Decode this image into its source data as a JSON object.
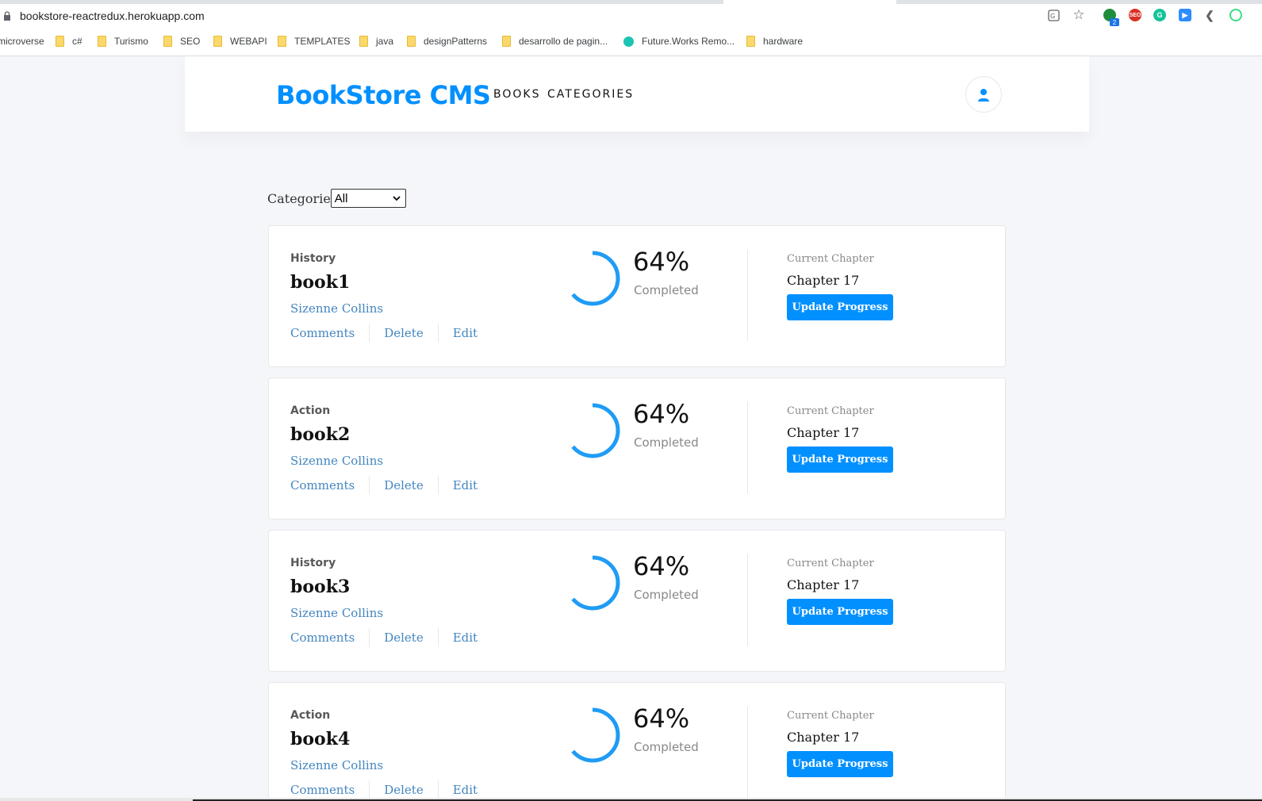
{
  "browser": {
    "url": "bookstore-reactredux.herokuapp.com",
    "bookmarks": [
      {
        "label": "microverse",
        "icon": "none"
      },
      {
        "label": "c#",
        "icon": "folder-icon"
      },
      {
        "label": "Turismo",
        "icon": "folder-icon"
      },
      {
        "label": "SEO",
        "icon": "folder-icon"
      },
      {
        "label": "WEBAPI",
        "icon": "folder-icon"
      },
      {
        "label": "TEMPLATES",
        "icon": "folder-icon"
      },
      {
        "label": "java",
        "icon": "folder-icon"
      },
      {
        "label": "designPatterns",
        "icon": "folder-icon"
      },
      {
        "label": "desarrollo de pagin...",
        "icon": "folder-icon"
      },
      {
        "label": "Future.Works Remo...",
        "icon": "site-icon"
      },
      {
        "label": "hardware",
        "icon": "folder-icon"
      }
    ],
    "extension_badge": "2"
  },
  "header": {
    "logo": "BookStore CMS",
    "nav": [
      "BOOKS",
      "CATEGORIES"
    ],
    "avatar_icon": "user-icon"
  },
  "filter": {
    "label": "Categorie",
    "selected": "All"
  },
  "books": [
    {
      "genre": "History",
      "title": "book1",
      "author": "Sizenne Collins",
      "actions": [
        "Comments",
        "Delete",
        "Edit"
      ],
      "percent_label": "64%",
      "progress": 0.64,
      "completed_label": "Completed",
      "chapter_label": "Current Chapter",
      "chapter": "Chapter 17",
      "button": "Update Progress"
    },
    {
      "genre": "Action",
      "title": "book2",
      "author": "Sizenne Collins",
      "actions": [
        "Comments",
        "Delete",
        "Edit"
      ],
      "percent_label": "64%",
      "progress": 0.64,
      "completed_label": "Completed",
      "chapter_label": "Current Chapter",
      "chapter": "Chapter 17",
      "button": "Update Progress"
    },
    {
      "genre": "History",
      "title": "book3",
      "author": "Sizenne Collins",
      "actions": [
        "Comments",
        "Delete",
        "Edit"
      ],
      "percent_label": "64%",
      "progress": 0.64,
      "completed_label": "Completed",
      "chapter_label": "Current Chapter",
      "chapter": "Chapter 17",
      "button": "Update Progress"
    },
    {
      "genre": "Action",
      "title": "book4",
      "author": "Sizenne Collins",
      "actions": [
        "Comments",
        "Delete",
        "Edit"
      ],
      "percent_label": "64%",
      "progress": 0.64,
      "completed_label": "Completed",
      "chapter_label": "Current Chapter",
      "chapter": "Chapter 17",
      "button": "Update Progress"
    }
  ],
  "colors": {
    "accent": "#0290ff",
    "link": "#4386bf",
    "background": "#f5f6fa"
  }
}
